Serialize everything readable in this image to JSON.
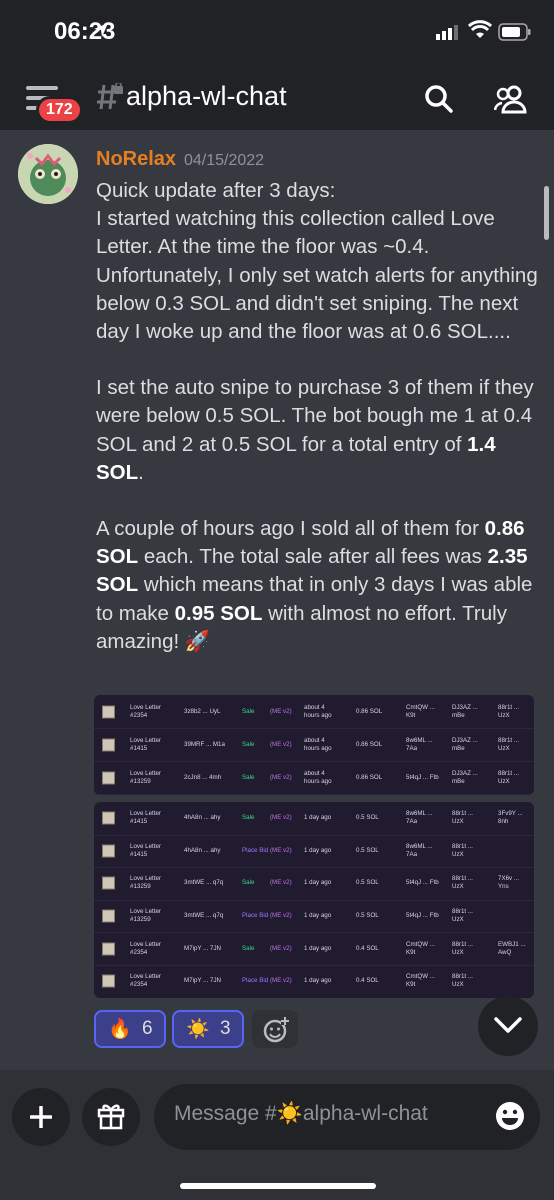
{
  "status": {
    "time": "06:23"
  },
  "header": {
    "badge_count": "172",
    "channel_name": "alpha-wl-chat"
  },
  "message": {
    "username": "NoRelax",
    "date": "04/15/2022",
    "p1_line1": "Quick update after 3 days:",
    "p1_rest": "I started watching this collection called Love Letter. At the time the floor was ~0.4. Unfortunately, I only set watch alerts for anything below 0.3 SOL and didn't set sniping. The next day I woke up and the floor was at 0.6 SOL....",
    "p2_a": "I set the auto snipe to purchase 3 of them if they were below 0.5 SOL. The bot bough me 1 at 0.4 SOL and 2 at 0.5 SOL for a total entry of ",
    "p2_b": "1.4 SOL",
    "p2_c": ".",
    "p3_a": "A couple of hours ago I sold all of them for ",
    "p3_b": "0.86 SOL",
    "p3_c": " each. The total sale after all fees was ",
    "p3_d": "2.35 SOL",
    "p3_e": " which means that in only 3 days I was able to make ",
    "p3_f": "0.95 SOL",
    "p3_g": " with almost no effort. Truly amazing! 🚀"
  },
  "table1": [
    {
      "name1": "Love Letter",
      "name2": "#2354",
      "sig": "3z8b2 ... UyL",
      "type": "Sale",
      "mkt": "(ME v2)",
      "t1": "about 4",
      "t2": "hours ago",
      "price": "0.86 SOL",
      "b1": "CmtQW ...",
      "b2": "K9t",
      "s1": "DJ3AZ ...",
      "s2": "mBe",
      "d1": "88r1t ...",
      "d2": "UzX"
    },
    {
      "name1": "Love Letter",
      "name2": "#1415",
      "sig": "39MRF ... M1a",
      "type": "Sale",
      "mkt": "(ME v2)",
      "t1": "about 4",
      "t2": "hours ago",
      "price": "0.86 SOL",
      "b1": "8w6ML ...",
      "b2": "7Aa",
      "s1": "DJ3AZ ...",
      "s2": "mBe",
      "d1": "88r1t ...",
      "d2": "UzX"
    },
    {
      "name1": "Love Letter",
      "name2": "#13259",
      "sig": "2cJn8 ... 4mh",
      "type": "Sale",
      "mkt": "(ME v2)",
      "t1": "about 4",
      "t2": "hours ago",
      "price": "0.86 SOL",
      "b1": "5t4qJ ... Ftb",
      "b2": "",
      "s1": "DJ3AZ ...",
      "s2": "mBe",
      "d1": "88r1t ...",
      "d2": "UzX"
    }
  ],
  "table2": [
    {
      "name1": "Love Letter",
      "name2": "#1415",
      "sig": "4hA8n ... ahy",
      "type": "Sale",
      "mkt": "(ME v2)",
      "t1": "1 day ago",
      "t2": "",
      "price": "0.5 SOL",
      "b1": "8w6ML ...",
      "b2": "7Aa",
      "s1": "88r1t ...",
      "s2": "UzX",
      "d1": "3Fv9Y ...",
      "d2": "8nh"
    },
    {
      "name1": "Love Letter",
      "name2": "#1415",
      "sig": "4hA8n ... ahy",
      "type": "Place Bid",
      "mkt": "(ME v2)",
      "t1": "1 day ago",
      "t2": "",
      "price": "0.5 SOL",
      "b1": "8w6ML ...",
      "b2": "7Aa",
      "s1": "88r1t ...",
      "s2": "UzX",
      "d1": "",
      "d2": ""
    },
    {
      "name1": "Love Letter",
      "name2": "#13259",
      "sig": "3mtWE ... q7q",
      "type": "Sale",
      "mkt": "(ME v2)",
      "t1": "1 day ago",
      "t2": "",
      "price": "0.5 SOL",
      "b1": "5t4qJ ... Ftb",
      "b2": "",
      "s1": "88r1t ...",
      "s2": "UzX",
      "d1": "7X6v ...",
      "d2": "Yns"
    },
    {
      "name1": "Love Letter",
      "name2": "#13259",
      "sig": "3mtWE ... q7q",
      "type": "Place Bid",
      "mkt": "(ME v2)",
      "t1": "1 day ago",
      "t2": "",
      "price": "0.5 SOL",
      "b1": "5t4qJ ... Ftb",
      "b2": "",
      "s1": "88r1t ...",
      "s2": "UzX",
      "d1": "",
      "d2": ""
    },
    {
      "name1": "Love Letter",
      "name2": "#2354",
      "sig": "M7ipY ... 7JN",
      "type": "Sale",
      "mkt": "(ME v2)",
      "t1": "1 day ago",
      "t2": "",
      "price": "0.4 SOL",
      "b1": "CmtQW ...",
      "b2": "K9t",
      "s1": "88r1t ...",
      "s2": "UzX",
      "d1": "EWBJ1 ...",
      "d2": "AwQ"
    },
    {
      "name1": "Love Letter",
      "name2": "#2354",
      "sig": "M7ipY ... 7JN",
      "type": "Place Bid",
      "mkt": "(ME v2)",
      "t1": "1 day ago",
      "t2": "",
      "price": "0.4 SOL",
      "b1": "CmtQW ...",
      "b2": "K9t",
      "s1": "88r1t ...",
      "s2": "UzX",
      "d1": "",
      "d2": ""
    }
  ],
  "reactions": [
    {
      "emoji": "🔥",
      "count": "6"
    },
    {
      "emoji": "☀️",
      "count": "3"
    }
  ],
  "composer": {
    "placeholder": "Message #☀️alpha-wl-chat"
  },
  "colors": {
    "accent": "#5865f2",
    "username": "#e67e22",
    "badge": "#ed4245"
  }
}
